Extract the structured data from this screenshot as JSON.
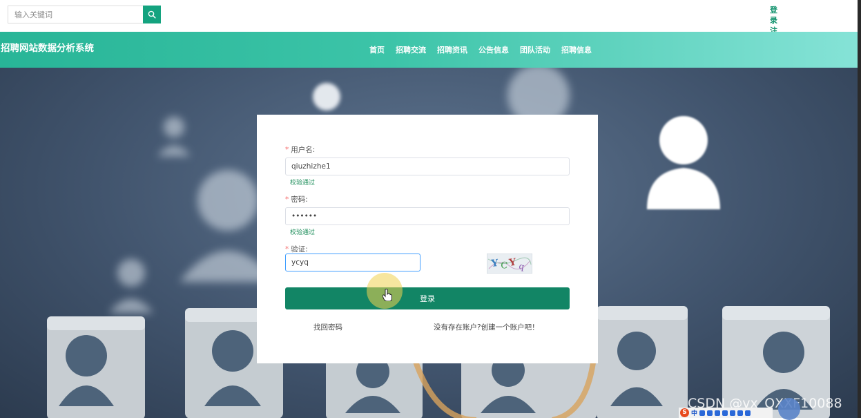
{
  "search": {
    "placeholder": "输入关键词"
  },
  "auth": {
    "login": "登录",
    "register": "注册"
  },
  "header": {
    "site_title": "招聘网站数据分析系统",
    "nav": [
      "首页",
      "招聘交流",
      "招聘资讯",
      "公告信息",
      "团队活动",
      "招聘信息"
    ]
  },
  "login_form": {
    "username_label": "用户名:",
    "username_value": "qiuzhizhe1",
    "username_status": "校验通过",
    "password_label": "密码:",
    "password_value": "••••••",
    "password_status": "校验通过",
    "captcha_label": "验证:",
    "captcha_value": "ycyq",
    "captcha_image_text": "YCYq",
    "submit_label": "登录",
    "forgot_link": "找回密码",
    "register_link": "没有存在账户?创建一个账户吧！"
  },
  "overlays": {
    "watermark": "CSDN @vx_QXXF10088",
    "ime_label": "中"
  },
  "colors": {
    "accent": "#14a37f",
    "login_button": "#128565",
    "valid_text": "#1f8f5c",
    "required_mark": "#f56c6c"
  }
}
